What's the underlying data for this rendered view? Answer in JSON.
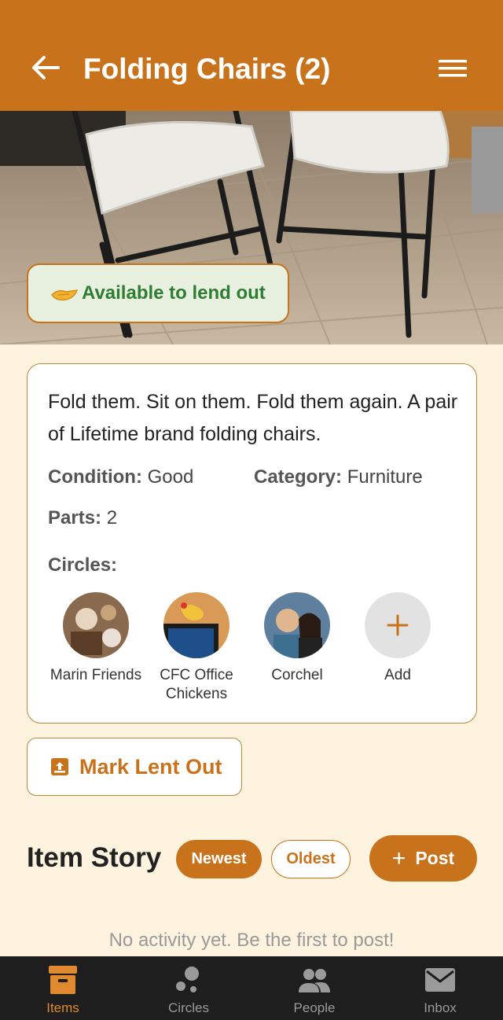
{
  "header": {
    "title": "Folding Chairs (2)"
  },
  "item": {
    "status": "Available to lend out",
    "description": "Fold them. Sit on them. Fold them again. A pair of Lifetime brand folding chairs.",
    "condition_label": "Condition:",
    "condition_value": "Good",
    "category_label": "Category:",
    "category_value": "Furniture",
    "parts_label": "Parts:",
    "parts_value": "2",
    "circles_heading": "Circles:",
    "circles": [
      {
        "name": "Marin Friends"
      },
      {
        "name": "CFC Office Chickens"
      },
      {
        "name": "Corchel"
      },
      {
        "name": "Add"
      }
    ]
  },
  "actions": {
    "mark_lent_out": "Mark Lent Out"
  },
  "story": {
    "title": "Item Story",
    "sort_newest": "Newest",
    "sort_oldest": "Oldest",
    "post_label": "Post",
    "empty_message": "No activity yet. Be the first to post!"
  },
  "nav": {
    "items": [
      {
        "label": "Items",
        "icon": "archive-icon",
        "active": true
      },
      {
        "label": "Circles",
        "icon": "bubbles-icon",
        "active": false
      },
      {
        "label": "People",
        "icon": "people-icon",
        "active": false
      },
      {
        "label": "Inbox",
        "icon": "mail-icon",
        "active": false
      }
    ]
  },
  "colors": {
    "primary": "#c8731c",
    "background": "#fef3de",
    "available_green": "#2e7d32",
    "nav_background": "#1e1e1e"
  }
}
